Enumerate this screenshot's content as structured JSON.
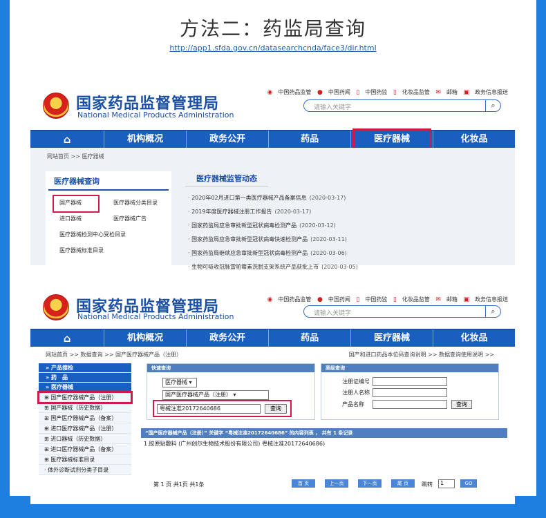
{
  "header": {
    "title": "方法二：药监局查询",
    "url": "http://app1.sfda.gov.cn/datasearchcnda/face3/dir.html"
  },
  "site": {
    "logo_cn": "国家药品监督管理局",
    "logo_en": "National Medical Products Administration",
    "top_links": [
      "中国药品监管",
      "中国药闻",
      "中国药监",
      "化妆品监管",
      "邮箱",
      "政务信息报送"
    ],
    "search_placeholder": "请输入关键字",
    "nav": [
      "机构概况",
      "政务公开",
      "药品",
      "医疗器械",
      "化妆品"
    ]
  },
  "shot1": {
    "breadcrumb": "网站首页 >> 医疗器械",
    "query_title": "医疗器械查询",
    "query_links": [
      "国产器械",
      "医疗器械分类目录",
      "进口器械",
      "医疗器械广告",
      "医疗器械检测中心受检目录",
      "医疗器械标准目录"
    ],
    "news_title": "医疗器械监管动态",
    "news": [
      {
        "text": "2020年02月进口第一类医疗器械产品备案信息",
        "date": "(2020-03-17)"
      },
      {
        "text": "2019年度医疗器械注册工作报告",
        "date": "(2020-03-17)"
      },
      {
        "text": "国家药监局应急审批新型冠状病毒检测产品",
        "date": "(2020-03-12)"
      },
      {
        "text": "国家药监局应急审批新型冠状病毒快速检测产品",
        "date": "(2020-03-11)"
      },
      {
        "text": "国家药监局继续应急审批新型冠状病毒检测产品",
        "date": "(2020-03-06)"
      },
      {
        "text": "生物可吸收冠脉雷帕霉素洗脱支架系统产品获批上市",
        "date": "(2020-03-05)"
      }
    ]
  },
  "shot2": {
    "breadcrumb": "网站首页 >> 数据查询 >> 国产医疗器械产品（注册）",
    "breadcrumb_right": "国产和进口药品本位码查询说明 >>      数据查询使用说明 >>",
    "side_bars": [
      "» 产品搜检",
      "» 药　品",
      "» 医疗器械"
    ],
    "side_items": [
      "国产医疗器械产品（注册）",
      "国产器械（历史数据）",
      "国产医疗器械产品（备案）",
      "进口医疗器械产品（注册）",
      "进口器械（历史数据）",
      "进口医疗器械产品（备案）",
      "医疗器械标准目录",
      "体外诊断试剂分类子目录"
    ],
    "fast_caption": "快速查询",
    "select1": "医疗器械 ▾",
    "select2": "国产医疗器械产品（注册）        ▾",
    "keyword": "粤械注准20172640686",
    "query_button": "查询",
    "adv_caption": "高级查询",
    "adv_fields": [
      "注册证编号",
      "注册人名称",
      "产品名称"
    ],
    "adv_button": "查询",
    "result_caption": "“国产医疗器械产品（注册）” 关键字 “粤械注准20172640686” 的内容列表 ， 共有 1 条记录",
    "result_row": "1.胶原贴敷料 (广州创尔生物技术股份有限公司) 粤械注准20172640686)",
    "pager_text": "第 1 页 共1页 共1条",
    "pager_buttons": [
      "首 页",
      "上一页",
      "下一页",
      "尾 页"
    ],
    "jump_label": "跳转",
    "jump_value": "1",
    "go": "GO"
  }
}
